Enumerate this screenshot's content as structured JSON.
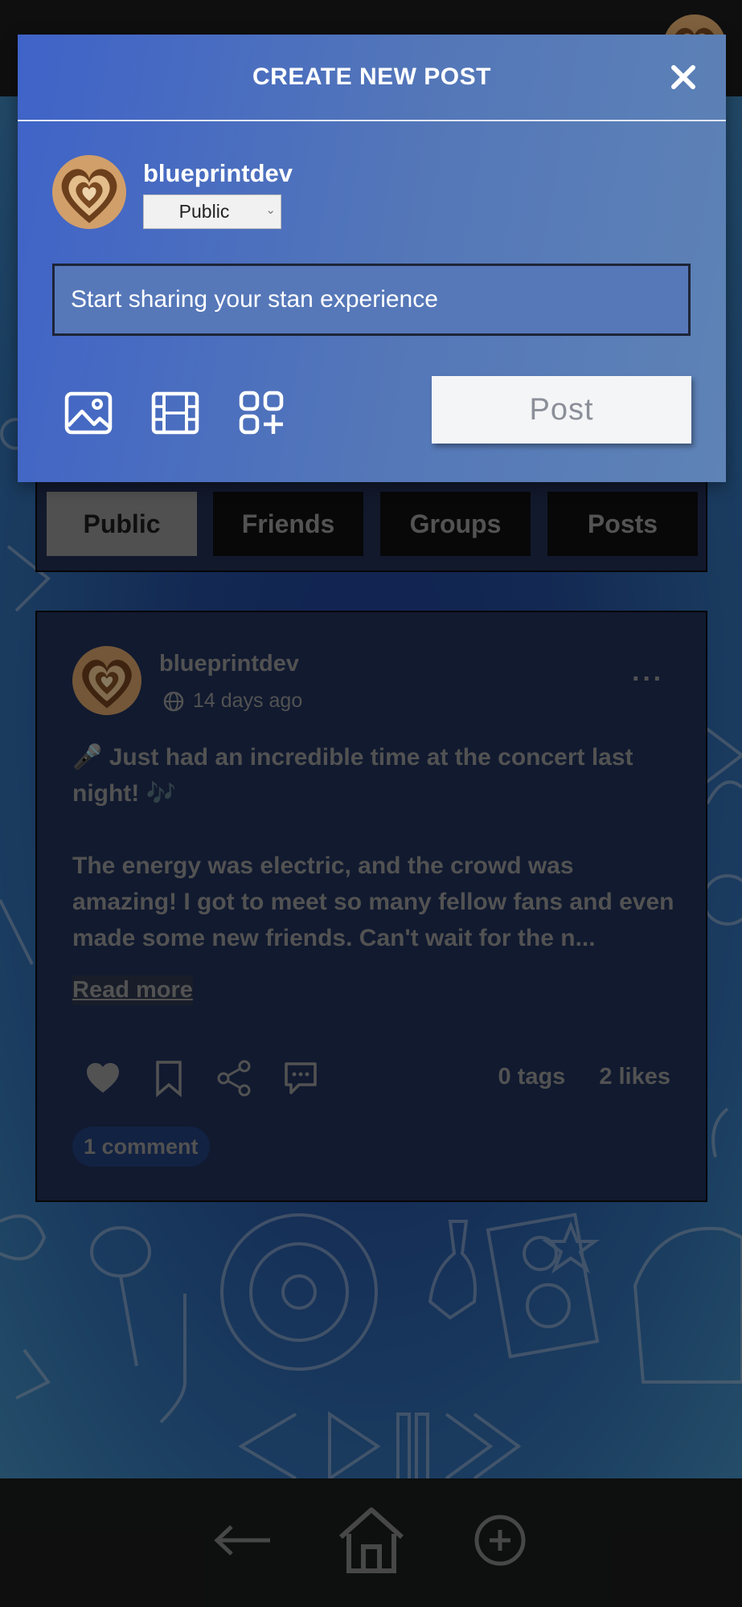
{
  "modal": {
    "title": "CREATE NEW POST",
    "username": "blueprintdev",
    "privacy_selected": "Public",
    "input_placeholder": "Start sharing your stan experience",
    "post_button": "Post",
    "icons": [
      "image-icon",
      "video-icon",
      "add-widget-icon"
    ]
  },
  "filter_tabs": [
    {
      "label": "Public",
      "active": true
    },
    {
      "label": "Friends",
      "active": false
    },
    {
      "label": "Groups",
      "active": false
    },
    {
      "label": "Posts",
      "active": false
    }
  ],
  "post": {
    "username": "blueprintdev",
    "time": "14 days ago",
    "line1": "🎤 Just had an incredible time at the concert last night! 🎶",
    "body": "The energy was electric, and the crowd was amazing! I got to meet so many fellow fans and even made some new friends. Can't wait for the n...",
    "read_more": "Read more",
    "tags": "0 tags",
    "likes": "2 likes",
    "comments": "1 comment"
  },
  "bottom_nav": [
    "back-arrow-icon",
    "home-icon",
    "add-circle-icon"
  ],
  "colors": {
    "modal_gradient_start": "#3f63c8",
    "modal_gradient_end": "#5e83b6",
    "active_tab": "#8a8a8a",
    "inactive_tab": "#0f0f10",
    "post_card": "#1e2d52"
  }
}
